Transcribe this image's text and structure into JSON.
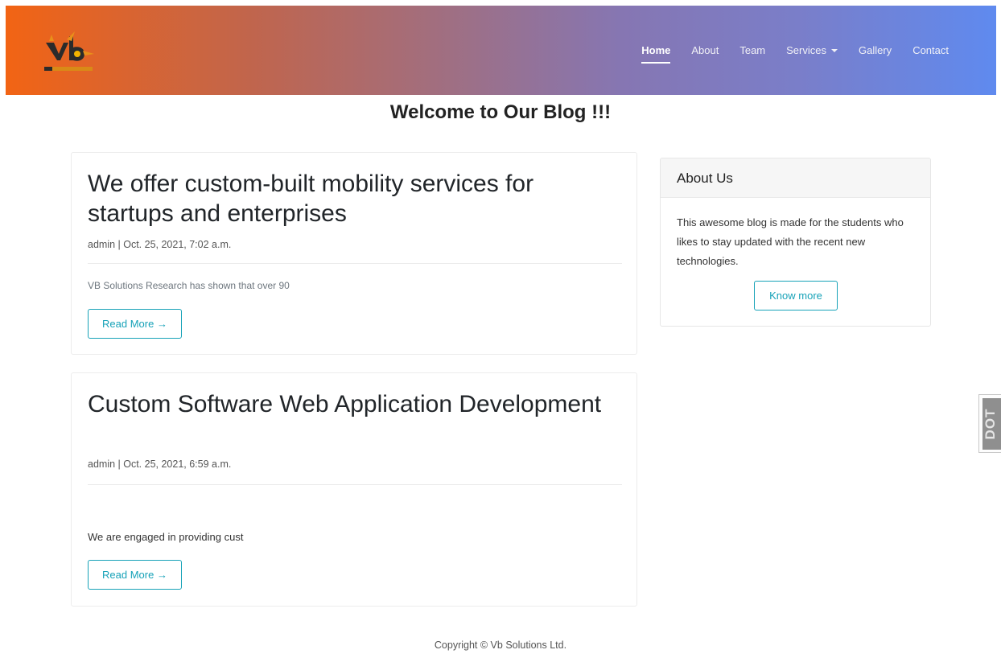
{
  "brand": {
    "logo_icon": "vb-solutions-logo",
    "colors": {
      "gradient_start": "#f26414",
      "gradient_end": "#5f8aef",
      "accent": "#17a2b8"
    }
  },
  "nav": {
    "items": [
      {
        "label": "Home",
        "active": true
      },
      {
        "label": "About",
        "active": false
      },
      {
        "label": "Team",
        "active": false
      },
      {
        "label": "Services",
        "active": false,
        "dropdown": true
      },
      {
        "label": "Gallery",
        "active": false
      },
      {
        "label": "Contact",
        "active": false
      }
    ]
  },
  "page": {
    "title": "Welcome to Our Blog !!!"
  },
  "posts": [
    {
      "title": "We offer custom-built mobility services for startups and enterprises",
      "meta": "admin | Oct. 25, 2021, 7:02 a.m.",
      "excerpt": "VB Solutions Research has shown that over 90",
      "button": "Read More →"
    },
    {
      "title": "Custom Software Web Application Development",
      "meta": "admin | Oct. 25, 2021, 6:59 a.m.",
      "excerpt": "We are engaged in providing cust",
      "button": "Read More →"
    }
  ],
  "sidebar": {
    "header": "About Us",
    "body": "This awesome blog is made for the students who likes to stay updated with the recent new technologies.",
    "button": "Know more"
  },
  "side_tab": {
    "label": "DOT"
  },
  "footer": {
    "copyright": "Copyright © Vb Solutions Ltd."
  }
}
